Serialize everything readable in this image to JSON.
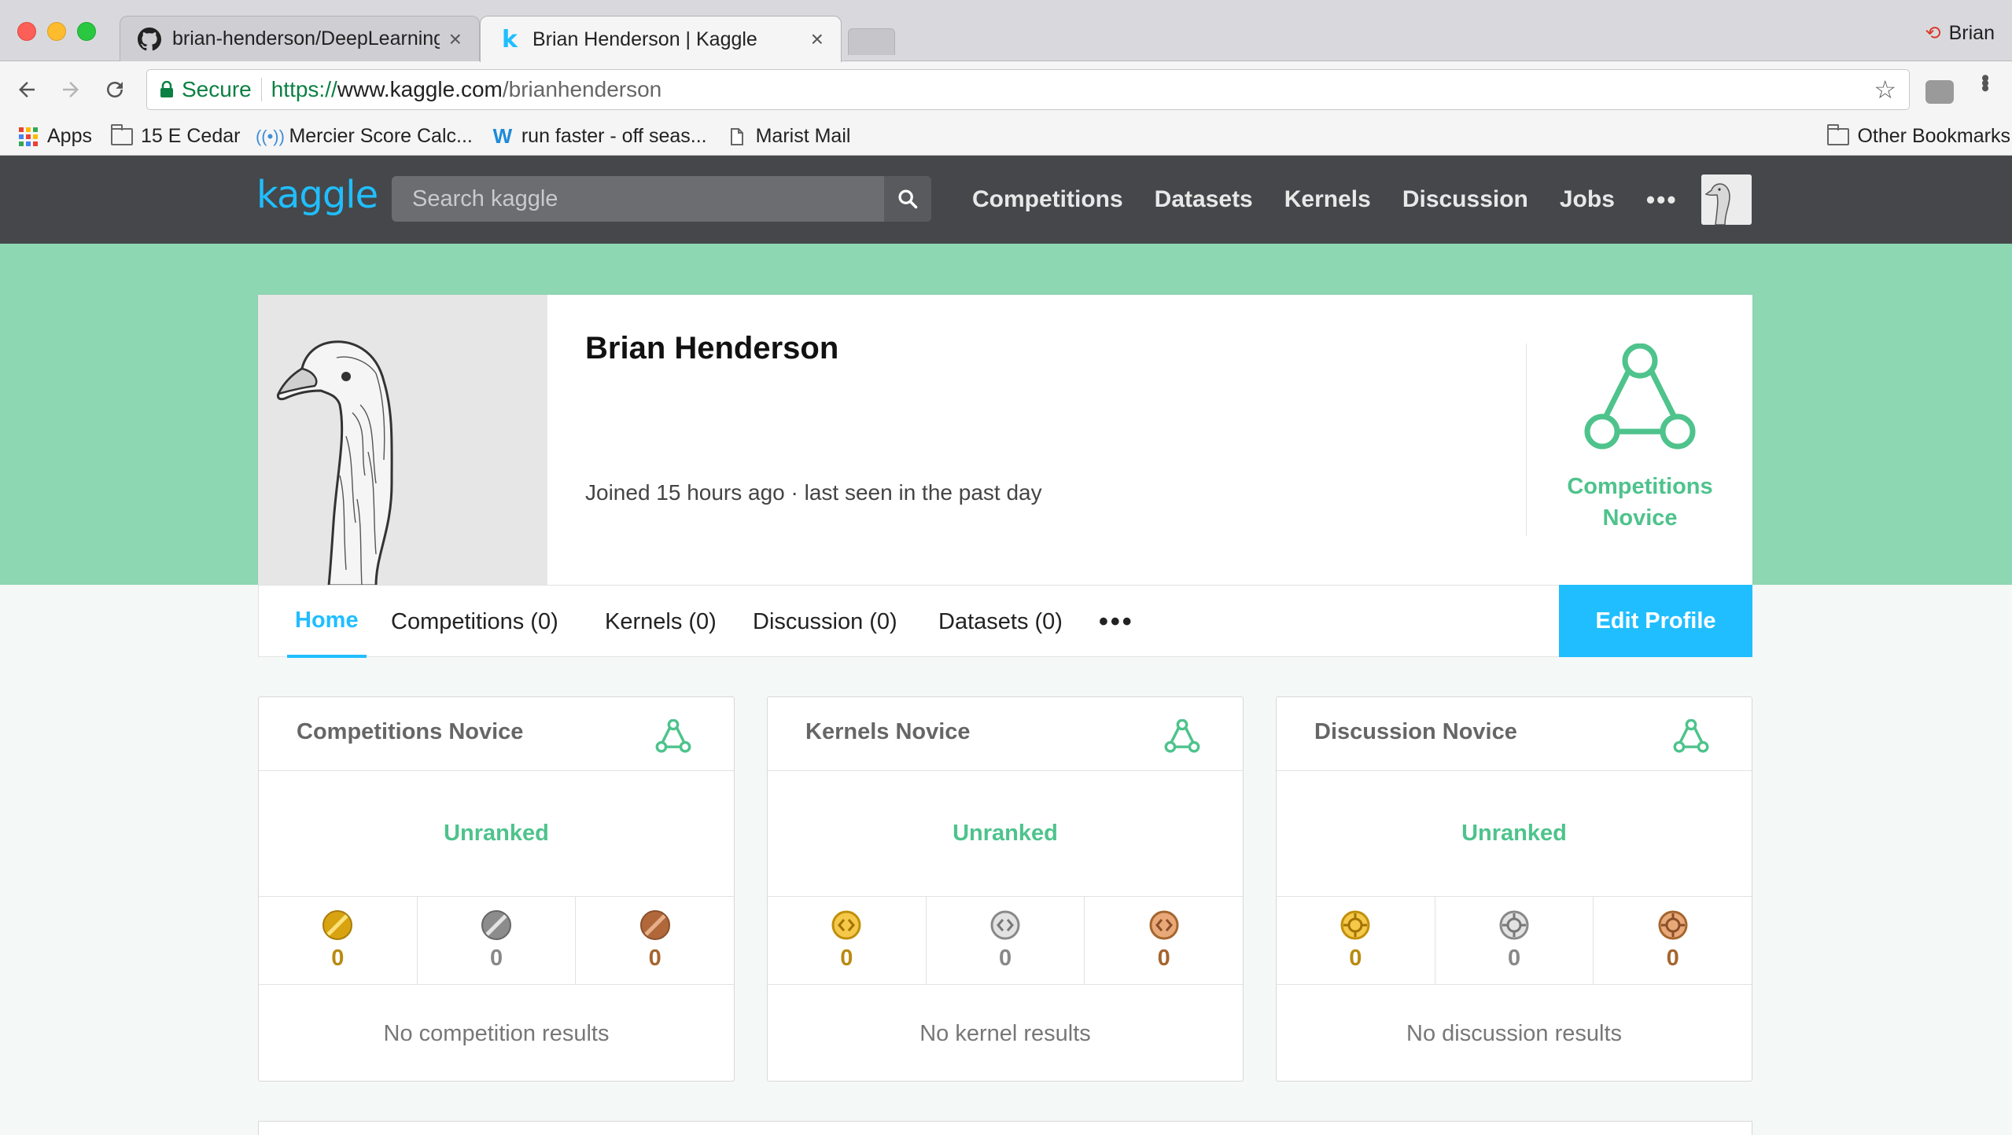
{
  "browser": {
    "tabs": [
      {
        "title": "brian-henderson/DeepLearning",
        "icon": "github-icon",
        "active": false
      },
      {
        "title": "Brian Henderson | Kaggle",
        "icon": "kaggle-k-icon",
        "active": true
      }
    ],
    "tab_close": "×",
    "profile_name": "Brian",
    "secure_label": "Secure",
    "url_scheme": "https://",
    "url_host": "www.kaggle.com",
    "url_path": "/brianhenderson",
    "bookmarks": [
      {
        "label": "Apps",
        "icon": "apps-grid-icon"
      },
      {
        "label": "15 E Cedar",
        "icon": "folder-icon"
      },
      {
        "label": "Mercier Score Calc...",
        "icon": "antenna-icon"
      },
      {
        "label": "run faster - off seas...",
        "icon": "wordpress-w-icon"
      },
      {
        "label": "Marist Mail",
        "icon": "page-icon"
      }
    ],
    "other_bookmarks": "Other Bookmarks"
  },
  "kaggle": {
    "logo": "kaggle",
    "search_placeholder": "Search kaggle",
    "nav": [
      "Competitions",
      "Datasets",
      "Kernels",
      "Discussion",
      "Jobs"
    ],
    "nav_more": "•••",
    "brand_color": "#20beff",
    "novice_color": "#4ec38c"
  },
  "profile": {
    "name": "Brian Henderson",
    "joined": "Joined 15 hours ago · last seen in the past day",
    "tier_label": "Competitions Novice",
    "tabs": [
      "Home",
      "Competitions (0)",
      "Kernels (0)",
      "Discussion (0)",
      "Datasets (0)"
    ],
    "tabs_more": "•••",
    "edit_button": "Edit Profile"
  },
  "cards": [
    {
      "title": "Competitions Novice",
      "rank": "Unranked",
      "medals": [
        {
          "count": "0",
          "type": "gold"
        },
        {
          "count": "0",
          "type": "silver"
        },
        {
          "count": "0",
          "type": "bronze"
        }
      ],
      "empty": "No competition results",
      "medal_icon": "competition-medal-icon"
    },
    {
      "title": "Kernels Novice",
      "rank": "Unranked",
      "medals": [
        {
          "count": "0",
          "type": "gold"
        },
        {
          "count": "0",
          "type": "silver"
        },
        {
          "count": "0",
          "type": "bronze"
        }
      ],
      "empty": "No kernel results",
      "medal_icon": "kernel-medal-icon"
    },
    {
      "title": "Discussion Novice",
      "rank": "Unranked",
      "medals": [
        {
          "count": "0",
          "type": "gold"
        },
        {
          "count": "0",
          "type": "silver"
        },
        {
          "count": "0",
          "type": "bronze"
        }
      ],
      "empty": "No discussion results",
      "medal_icon": "discussion-medal-icon"
    }
  ],
  "medal_colors": {
    "gold": "#d8a310",
    "silver": "#8c8c8c",
    "bronze": "#b0683a",
    "gold_text": "#b88a10",
    "silver_text": "#888888",
    "bronze_text": "#a5652e"
  }
}
